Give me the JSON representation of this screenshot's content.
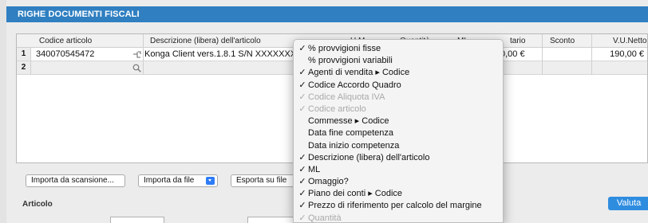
{
  "panel": {
    "title": "RIGHE DOCUMENTI FISCALI"
  },
  "grid": {
    "headers": [
      "Codice articolo",
      "Descrizione (libera) dell'articolo",
      "U.M.",
      "Quantità",
      "ML",
      "V.Unitario",
      "Sconto",
      "V.U.Netto"
    ],
    "rows": [
      {
        "num": "1",
        "codice": "340070545472",
        "descrizione": "Konga Client vers.1.8.1 S/N XXXXXXXXXX",
        "vunitario": "190,00 €",
        "sconto": "",
        "vunetto": "190,00 €"
      },
      {
        "num": "2",
        "codice": "",
        "descrizione": "",
        "vunitario": "",
        "sconto": "",
        "vunetto": ""
      }
    ],
    "visible_header_fragments": {
      "um": "U.M.",
      "qta": "Quantità",
      "ml": "ML",
      "vunit_tail": "tario",
      "vunit_value_tail": "0,00 €"
    }
  },
  "buttons": {
    "importa_scansione": "Importa da scansione...",
    "importa_file": "Importa da file",
    "esporta_file": "Esporta su file"
  },
  "section": {
    "articolo": "Articolo",
    "valuta": "Valuta"
  },
  "column_menu": {
    "items": [
      {
        "label": "% provvigioni fisse",
        "checked": true,
        "disabled": false
      },
      {
        "label": "% provvigioni variabili",
        "checked": false,
        "disabled": false
      },
      {
        "label": "Agenti di vendita ▸ Codice",
        "checked": true,
        "disabled": false
      },
      {
        "label": "Codice Accordo Quadro",
        "checked": true,
        "disabled": false
      },
      {
        "label": "Codice Aliquota IVA",
        "checked": true,
        "disabled": true
      },
      {
        "label": "Codice articolo",
        "checked": true,
        "disabled": true
      },
      {
        "label": "Commesse ▸ Codice",
        "checked": false,
        "disabled": false
      },
      {
        "label": "Data fine competenza",
        "checked": false,
        "disabled": false
      },
      {
        "label": "Data inizio competenza",
        "checked": false,
        "disabled": false
      },
      {
        "label": "Descrizione (libera) dell'articolo",
        "checked": true,
        "disabled": false
      },
      {
        "label": "ML",
        "checked": true,
        "disabled": false
      },
      {
        "label": "Omaggio?",
        "checked": true,
        "disabled": false
      },
      {
        "label": "Piano dei conti ▸ Codice",
        "checked": true,
        "disabled": false
      },
      {
        "label": "Prezzo di riferimento per calcolo del margine",
        "checked": true,
        "disabled": false
      },
      {
        "label": "Quantità",
        "checked": true,
        "disabled": true
      }
    ]
  },
  "colors": {
    "title_bar": "#2f7fc1",
    "valuta_button": "#2f8de0",
    "select_arrow": "#2e7cf6"
  }
}
